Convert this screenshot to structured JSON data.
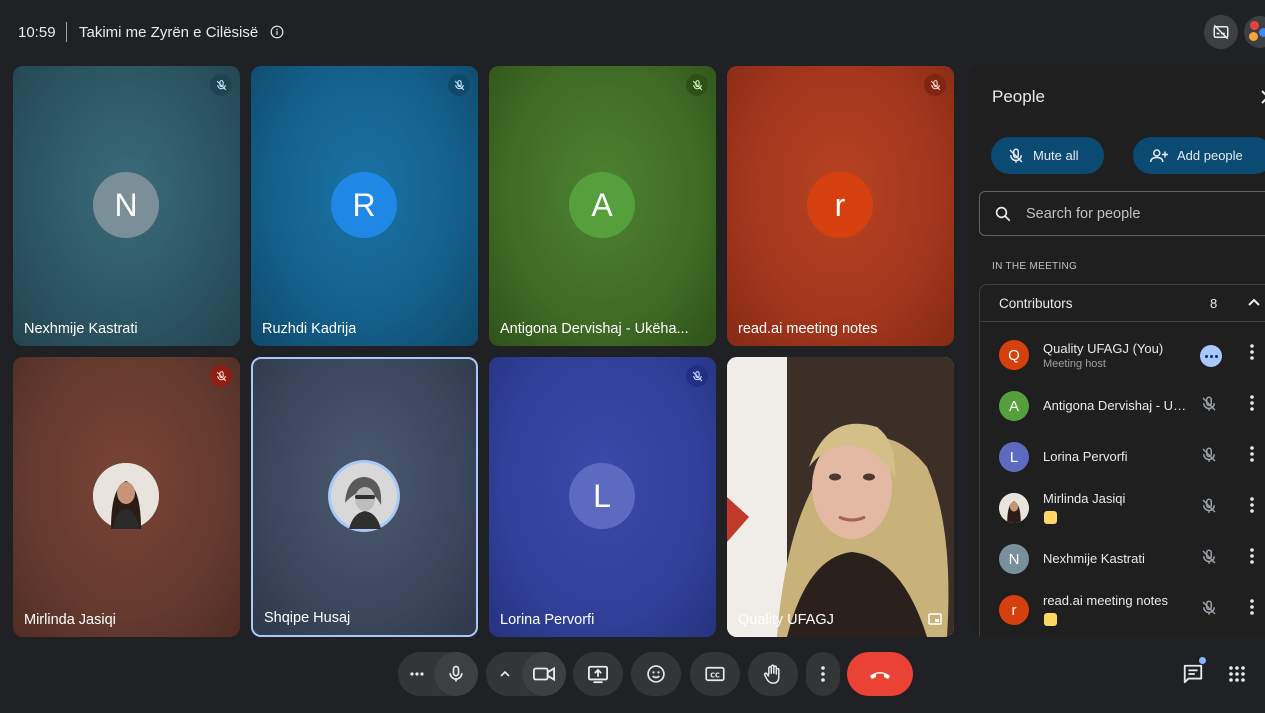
{
  "header": {
    "time": "10:59",
    "meeting_title": "Takimi me Zyrën e Cilësisë"
  },
  "tiles": [
    {
      "name": "Nexhmije Kastrati",
      "initial": "N",
      "avatar_color": "#7b8f99",
      "bg": "#2f5866",
      "mic_badge_color": "#1e4452"
    },
    {
      "name": "Ruzhdi Kadrija",
      "initial": "R",
      "avatar_color": "#1f88e5",
      "bg": "#135e86",
      "mic_badge_color": "#0f4a6b"
    },
    {
      "name": "Antigona Dervishaj - Ukëha...",
      "initial": "A",
      "avatar_color": "#55a03c",
      "bg": "#3d6a22",
      "mic_badge_color": "#2c5017"
    },
    {
      "name": "read.ai meeting notes",
      "initial": "r",
      "avatar_color": "#d5400e",
      "bg": "#a8341b",
      "mic_badge_color": "#7f2512"
    },
    {
      "name": "Mirlinda Jasiqi",
      "initial": "",
      "avatar_color": "#d9d3cf",
      "bg": "#6b3a30",
      "mic_badge_color": "#8e1f14"
    },
    {
      "name": "Shqipe Husaj",
      "initial": "",
      "avatar_color": "#c9c9c9",
      "bg": "#39465d",
      "mic_badge_color": ""
    },
    {
      "name": "Lorina Pervorfi",
      "initial": "L",
      "avatar_color": "#5c6bc0",
      "bg": "#2f3f95",
      "mic_badge_color": "#213084"
    },
    {
      "name": "Quality UFAGJ",
      "initial": "",
      "avatar_color": "",
      "bg": "#5a4638",
      "mic_badge_color": ""
    }
  ],
  "people_panel": {
    "title": "People",
    "mute_all_label": "Mute all",
    "add_people_label": "Add people",
    "search_placeholder": "Search for people",
    "section_label": "IN THE MEETING",
    "group_label": "Contributors",
    "group_count": "8",
    "people": [
      {
        "name": "Quality UFAGJ (You)",
        "sub": "Meeting host",
        "initial": "Q",
        "color": "#d5400e"
      },
      {
        "name": "Antigona Dervishaj - Uk...",
        "sub": "",
        "initial": "A",
        "color": "#55a03c"
      },
      {
        "name": "Lorina Pervorfi",
        "sub": "",
        "initial": "L",
        "color": "#5c6bc0"
      },
      {
        "name": "Mirlinda Jasiqi",
        "sub": "",
        "initial": "",
        "color": "#b9a89e"
      },
      {
        "name": "Nexhmije Kastrati",
        "sub": "",
        "initial": "N",
        "color": "#78909c"
      },
      {
        "name": "read.ai meeting notes",
        "sub": "",
        "initial": "r",
        "color": "#d5400e"
      }
    ]
  },
  "icons": {
    "info": "info-icon",
    "captions_off": "captions-off-icon",
    "more": "more-horiz-icon",
    "mic": "mic-icon",
    "camera": "videocam-icon",
    "present": "present-icon",
    "emoji": "emoji-icon",
    "captions": "cc-icon",
    "hand": "raise-hand-icon",
    "end_call": "call-end-icon",
    "chat": "chat-icon",
    "apps": "apps-icon"
  }
}
